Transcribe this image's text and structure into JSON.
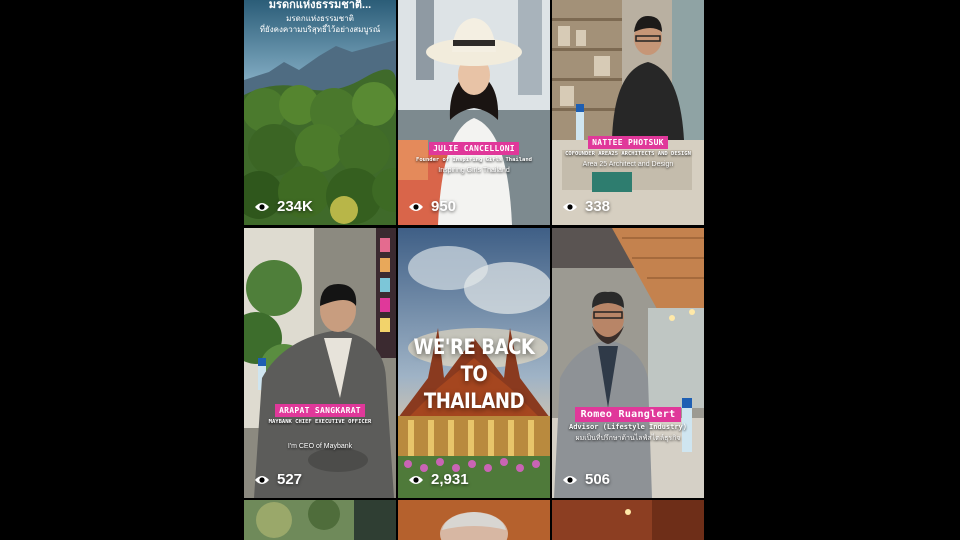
{
  "feed": {
    "tiles": [
      {
        "id": "nature",
        "views": "234K",
        "title_top": "มรดกแห่งธรรมชาติ...",
        "title_line1": "มรดกแห่งธรรมชาติ",
        "title_line2": "ที่ยังคงความบริสุทธิ์ไว้อย่างสมบูรณ์"
      },
      {
        "id": "julie",
        "views": "950",
        "name": "JULIE CANCELLONI",
        "role": "Founder of Inspiring Girls Thailand",
        "caption": "Inspiring Girls Thailand"
      },
      {
        "id": "nattee",
        "views": "338",
        "name": "NATTEE PHOTSUK",
        "role": "COFOUNDER AREA25 ARCHITECTS AND DESIGN",
        "caption": "Area 25 Architect and Design"
      },
      {
        "id": "arapat",
        "views": "527",
        "name": "ARAPAT SANGKARAT",
        "role": "MAYBANK CHIEF EXECUTIVE OFFICER",
        "caption": "I'm CEO of Maybank"
      },
      {
        "id": "temple",
        "views": "2,931",
        "headline_line1": "WE'RE BACK",
        "headline_line2": "TO THAILAND"
      },
      {
        "id": "romeo",
        "views": "506",
        "name": "Romeo Ruanglert",
        "role": "Advisor (Lifestyle Industry)",
        "caption": "ผมเป็นที่ปรึกษาด้านไลฟ์สไตล์ธุรกิจ"
      }
    ]
  },
  "colors": {
    "name_tag_pink": "#e0389a",
    "name_tag_blue": "#3b7be0",
    "background": "#000000"
  },
  "icons": {
    "views": "eye-icon"
  }
}
